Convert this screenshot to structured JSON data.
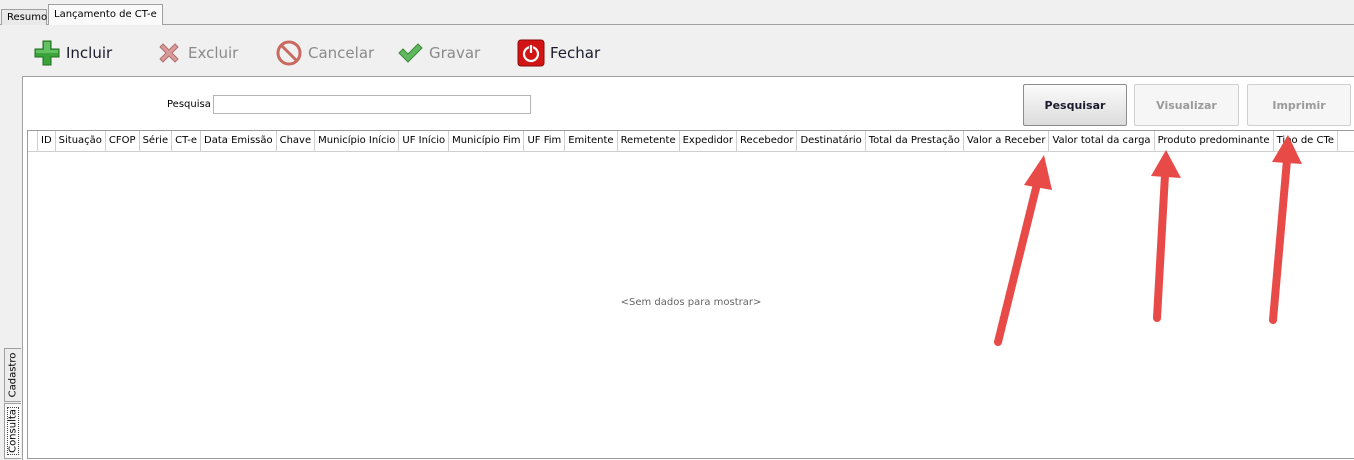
{
  "tabs": [
    {
      "label": "Resumo"
    },
    {
      "label": "Lançamento de CT-e"
    }
  ],
  "toolbar": {
    "incluir": "Incluir",
    "excluir": "Excluir",
    "cancelar": "Cancelar",
    "gravar": "Gravar",
    "fechar": "Fechar"
  },
  "search": {
    "label": "Pesquisa",
    "value": ""
  },
  "buttons": {
    "pesquisar": "Pesquisar",
    "visualizar": "Visualizar",
    "imprimir": "Imprimir"
  },
  "grid": {
    "columns": [
      "ID",
      "Situação",
      "CFOP",
      "Série",
      "CT-e",
      "Data Emissão",
      "Chave",
      "Município Início",
      "UF Início",
      "Município Fim",
      "UF Fim",
      "Emitente",
      "Remetente",
      "Expedidor",
      "Recebedor",
      "Destinatário",
      "Total da Prestação",
      "Valor a Receber",
      "Valor total da carga",
      "Produto predominante",
      "Tipo de CTe"
    ],
    "empty_text": "<Sem dados para mostrar>"
  },
  "side_tabs": [
    {
      "label": "Cadastro"
    },
    {
      "label": "Consulta"
    }
  ],
  "colors": {
    "add_green": "#3aa33a",
    "delete_red": "#c86a6a",
    "cancel_red": "#c0392b",
    "save_green": "#3a9a3a",
    "close_red": "#d31414",
    "arrow_red": "#e84a47"
  }
}
